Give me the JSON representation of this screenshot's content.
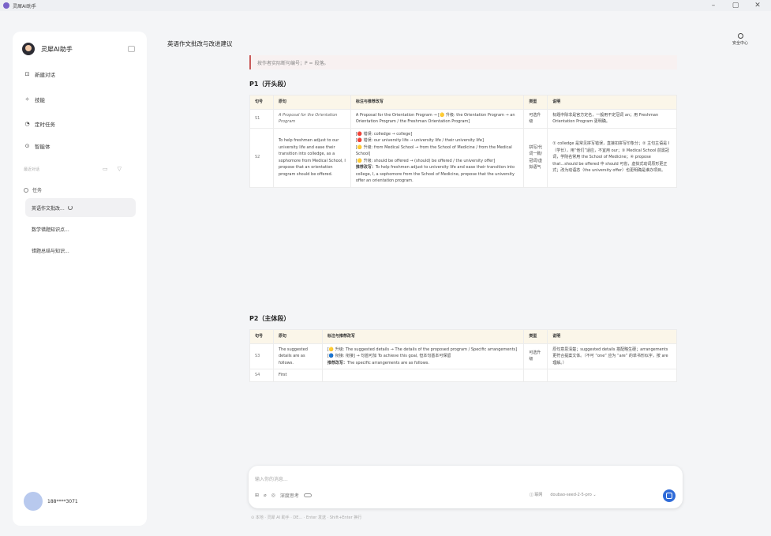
{
  "window": {
    "title": "灵犀AI助手",
    "min": "–",
    "max": "▢",
    "close": "✕"
  },
  "sidebar": {
    "brand": "灵犀AI助手",
    "nav": [
      {
        "icon": "⊡",
        "label": "新建对话"
      },
      {
        "icon": "✧",
        "label": "技能"
      },
      {
        "icon": "◔",
        "label": "定时任务"
      },
      {
        "icon": "⊙",
        "label": "智能体"
      }
    ],
    "recent_label": "最近对话",
    "task_group": "任务",
    "sessions": [
      {
        "label": "英语作文批改..."
      },
      {
        "label": "数学错题知识点..."
      },
      {
        "label": "错题总结与知识..."
      }
    ],
    "user": "188****3071"
  },
  "header": {
    "title": "英语作文批改与改进建议",
    "security": "安全中心"
  },
  "note": "按作者实际断句编号；P = 段落。",
  "p1": {
    "heading": "P1（开头段）",
    "cols": [
      "句号",
      "原句",
      "标注与推荐改写",
      "类型",
      "说明"
    ],
    "rows": [
      {
        "id": "S1",
        "orig": "A Proposal for the Orientation Program",
        "rev": "A Proposal for the Orientation Program → [🟡 升级: the Orientation Program → an Orientation Program / the Freshman Orientation Program]",
        "type": "可选升级",
        "note": "标题中除非是官方定名，一般用不定冠词 an；用 Freshman Orientation Program 更明确。"
      },
      {
        "id": "S2",
        "orig": "To help freshmen adjust to our university life and ease their transition into colledge, as a sophomore from Medical School, I propose that an orientation program should be offered.",
        "rev": "[🔴 错误: colledge → college]<br>[🔴 错误: our university life → university life / their university life]<br>[🟡 升级: from Medical School → from the School of Medicine / from the Medical School]<br>[🟡 升级: should be offered → (should) be offered / the university offer]<br>推荐改写：To help freshmen adjust to university life and ease their transition into college, I, a sophomore from the School of Medicine, propose that the university offer an orientation program.",
        "type": "拼写/代词一致/冠词/虚拟语气",
        "note": "① colledge 是常见拼写错误，直接扣拼写印象分；② 主句主语是 I（学长），用“他们”适应，不宜用 our；③ Medical School 前需冠词，学院名常用 the School of Medicine；④ propose that...should be offered 中 should 可省，虚拟式动词原形更正式；改为动语态（the university offer）也更明确是谁办项目。"
      }
    ]
  },
  "p2": {
    "heading": "P2（主体段）",
    "cols": [
      "句号",
      "原句",
      "标注与推荐改写",
      "类型",
      "说明"
    ],
    "rows": [
      {
        "id": "S3",
        "orig": "The suggested details are as follows.",
        "rev": "[🟡 升级: The suggested details → The details of the proposed program / Specific arrangements]<br>[🔵 衔接: 衔接] → 句首可加 To achieve this goal, 但本句基本可保留<br>推荐改写：The specific arrangements are as follows.",
        "type": "可选升级",
        "note": "原句意思清楚；suggested details 搭配略生硬；arrangements 更符合提案文体。（不可 “one” 应为 “are” 的单书形似字，按 are 理解。）"
      },
      {
        "id": "S4",
        "orig": "First",
        "rev": "",
        "type": "",
        "note": ""
      }
    ]
  },
  "composer": {
    "placeholder": "输入你的消息...",
    "deep_think": "深度思考",
    "net": "联网",
    "model": "doubao-seed-2-5-pro"
  },
  "footer": "⊙ 本地 · 灵犀 AI 助手 · DE...  ·  Enter 发送 · Shift+Enter 换行"
}
